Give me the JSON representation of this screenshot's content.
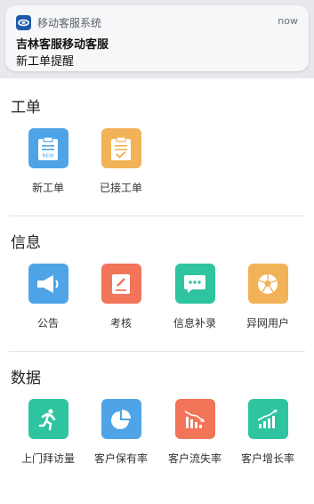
{
  "notification": {
    "app_name": "移动客服系统",
    "time": "now",
    "title": "吉林客服移动客服",
    "body": "新工单提醒"
  },
  "sections": [
    {
      "title": "工单",
      "items": [
        {
          "label": "新工单",
          "icon": "new-clipboard-icon",
          "color": "#4ea4e6"
        },
        {
          "label": "已接工单",
          "icon": "checked-clipboard-icon",
          "color": "#f2b257"
        }
      ]
    },
    {
      "title": "信息",
      "items": [
        {
          "label": "公告",
          "icon": "megaphone-icon",
          "color": "#4ea4e6"
        },
        {
          "label": "考核",
          "icon": "edit-note-icon",
          "color": "#f27459"
        },
        {
          "label": "信息补录",
          "icon": "chat-bubble-icon",
          "color": "#2fc4a0"
        },
        {
          "label": "异网用户",
          "icon": "network-ball-icon",
          "color": "#f2b257"
        }
      ]
    },
    {
      "title": "数据",
      "items": [
        {
          "label": "上门拜访量",
          "icon": "running-person-icon",
          "color": "#2fc4a0"
        },
        {
          "label": "客户保有率",
          "icon": "pie-chart-icon",
          "color": "#4ea4e6"
        },
        {
          "label": "客户流失率",
          "icon": "declining-bars-icon",
          "color": "#f27459"
        },
        {
          "label": "客户增长率",
          "icon": "rising-bars-icon",
          "color": "#2fc4a0"
        }
      ]
    }
  ]
}
